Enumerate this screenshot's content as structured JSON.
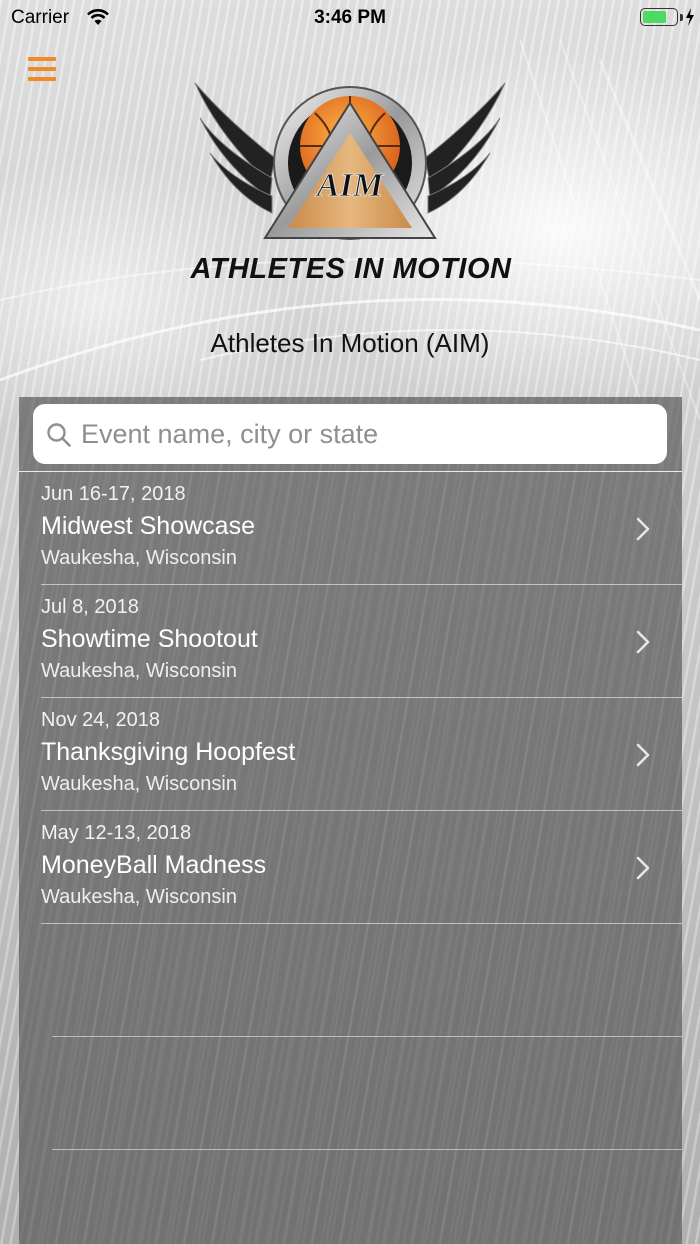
{
  "status_bar": {
    "carrier": "Carrier",
    "time": "3:46 PM",
    "battery_level": 0.75
  },
  "header": {
    "menu_icon": "hamburger-menu-icon",
    "logo_text": "ATHLETES IN MOTION",
    "logo_badge": "AIM",
    "title": "Athletes In Motion (AIM)"
  },
  "search": {
    "placeholder": "Event name, city or state",
    "value": ""
  },
  "events": [
    {
      "date": "Jun 16-17, 2018",
      "name": "Midwest Showcase",
      "location": "Waukesha, Wisconsin"
    },
    {
      "date": "Jul 8, 2018",
      "name": "Showtime Shootout",
      "location": "Waukesha, Wisconsin"
    },
    {
      "date": "Nov 24, 2018",
      "name": "Thanksgiving Hoopfest",
      "location": "Waukesha, Wisconsin"
    },
    {
      "date": "May 12-13, 2018",
      "name": "MoneyBall Madness",
      "location": "Waukesha, Wisconsin"
    }
  ],
  "colors": {
    "accent": "#f08a24",
    "battery": "#4cd964"
  }
}
